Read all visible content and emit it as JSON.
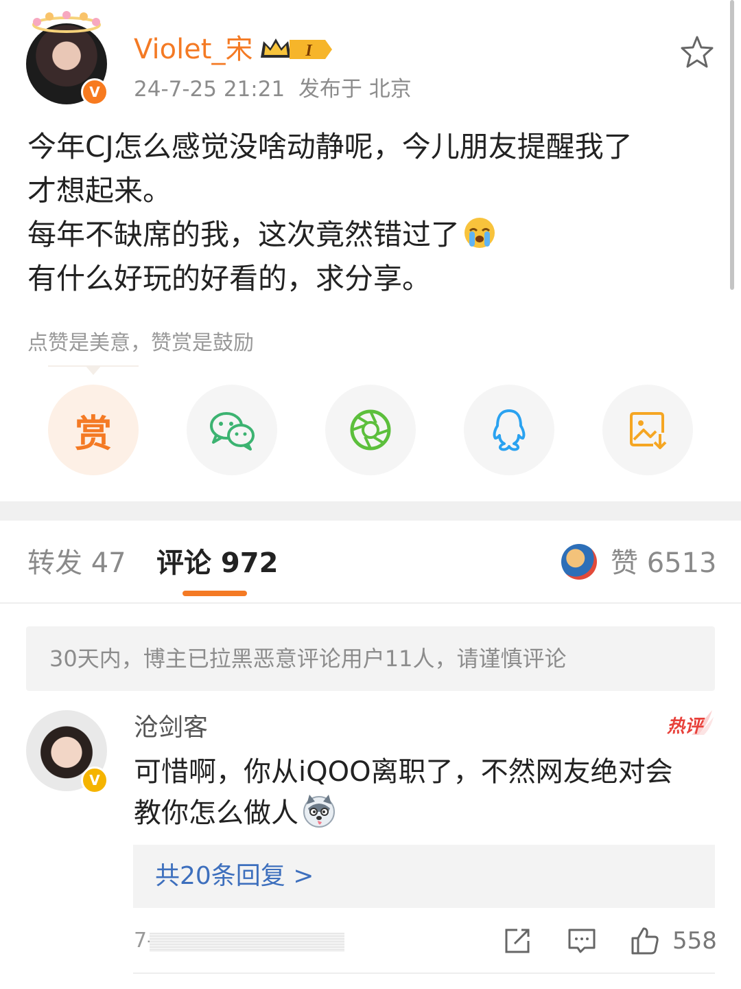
{
  "post": {
    "author": "Violet_宋",
    "level_badge": "I",
    "meta": "24-7-25 21:21  发布于 北京",
    "lines": [
      "今年CJ怎么感觉没啥动静呢，今儿朋友提醒我了",
      "才想起来。",
      "每年不缺席的我，这次竟然错过了",
      "有什么好玩的好看的，求分享。"
    ],
    "inline_emoji": "crying-face-emoji"
  },
  "reward": {
    "hint": "点赞是美意，赞赏是鼓励",
    "reward_char": "赏"
  },
  "share_icons": [
    "reward-icon",
    "wechat-icon",
    "moments-icon",
    "qq-icon",
    "save-image-icon"
  ],
  "tabs": {
    "repost": "转发 47",
    "comments": "评论 972",
    "likes": "赞 6513"
  },
  "notice": "30天内，博主已拉黑恶意评论用户11人，请谨慎评论",
  "comment": {
    "name": "沧剑客",
    "hot_label": "热评",
    "lines": [
      "可惜啊，你从iQOO离职了，不然网友绝对会",
      "教你怎么做人"
    ],
    "replies": "共20条回复 >",
    "date": "7-",
    "like_count": "558"
  },
  "colors": {
    "accent": "#f47a24",
    "link": "#3d6fbd",
    "wechat": "#3cb371",
    "moments": "#5cbf3c",
    "qq": "#2aa2f0",
    "save": "#f5a623"
  }
}
